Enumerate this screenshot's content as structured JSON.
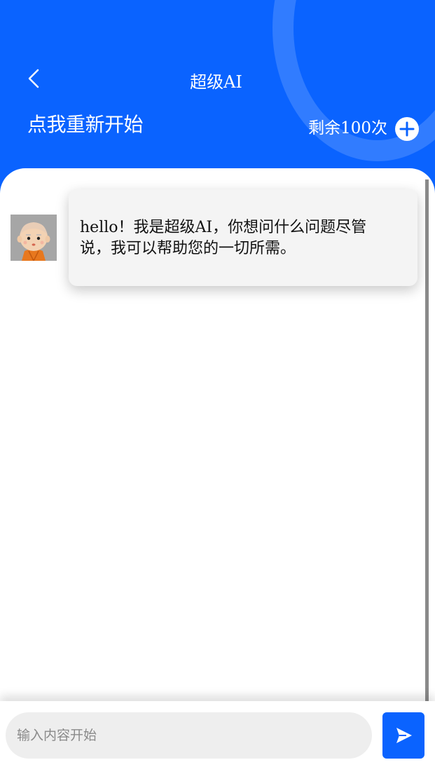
{
  "header": {
    "title": "超级AI",
    "restart_label": "点我重新开始",
    "remaining_label": "剩余100次",
    "back_icon": "chevron-left-icon",
    "add_icon": "plus-circle-icon",
    "background_color": "#0a63ff"
  },
  "chat": {
    "messages": [
      {
        "sender": "bot",
        "avatar_icon": "monk-avatar",
        "text": "hello！我是超级AI，你想问什么问题尽管说，我可以帮助您的一切所需。"
      }
    ]
  },
  "input": {
    "value": "",
    "placeholder": "输入内容开始",
    "send_icon": "send-arrow-icon"
  }
}
